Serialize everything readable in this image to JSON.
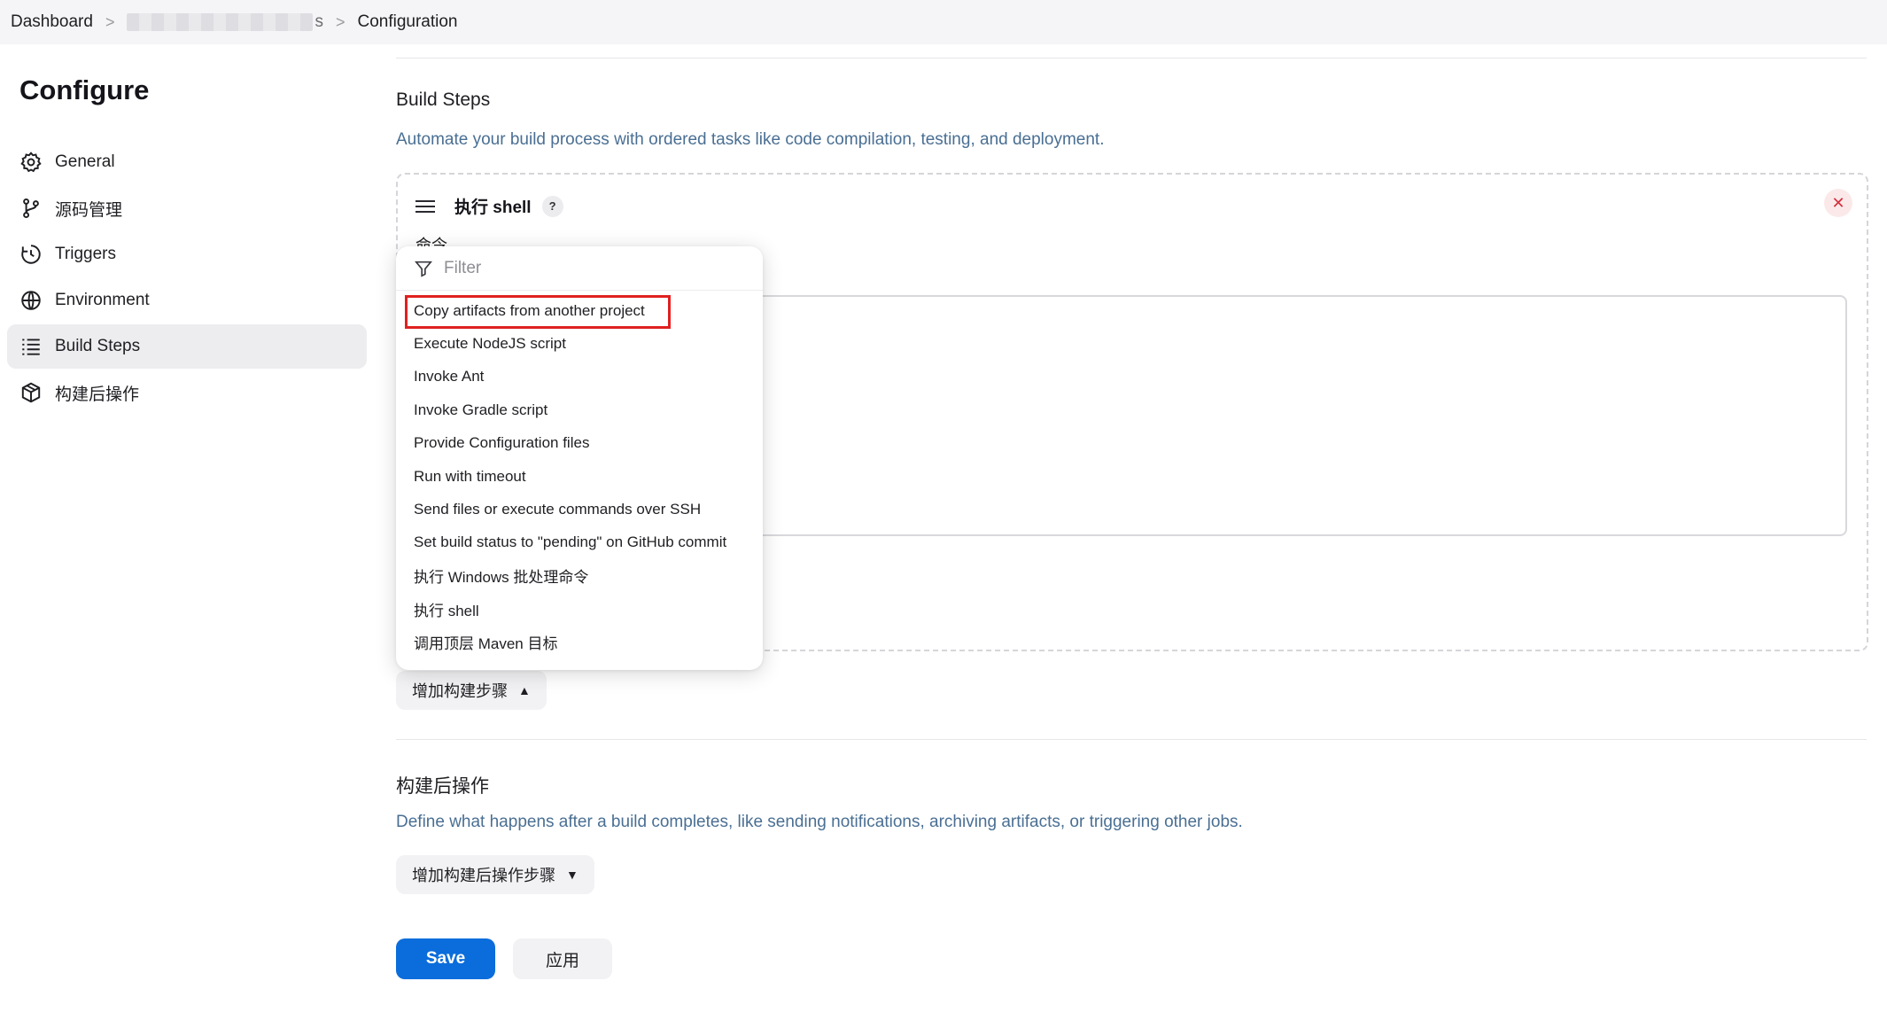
{
  "breadcrumb": {
    "items": [
      "Dashboard",
      "s",
      "Configuration"
    ],
    "separator": ">"
  },
  "sidebar": {
    "title": "Configure",
    "items": [
      {
        "label": "General",
        "icon": "gear-icon"
      },
      {
        "label": "源码管理",
        "icon": "git-branch-icon"
      },
      {
        "label": "Triggers",
        "icon": "clock-icon"
      },
      {
        "label": "Environment",
        "icon": "globe-icon"
      },
      {
        "label": "Build Steps",
        "icon": "list-icon",
        "active": true
      },
      {
        "label": "构建后操作",
        "icon": "package-icon"
      }
    ]
  },
  "build_steps": {
    "title": "Build Steps",
    "description": "Automate your build process with ordered tasks like code compilation, testing, and deployment.",
    "step": {
      "title": "执行 shell",
      "help": "?",
      "close": "✕",
      "command_label": "命令",
      "command_value": ""
    },
    "add_button": "增加构建步骤"
  },
  "dropdown": {
    "filter_placeholder": "Filter",
    "items": [
      "Copy artifacts from another project",
      "Execute NodeJS script",
      "Invoke Ant",
      "Invoke Gradle script",
      "Provide Configuration files",
      "Run with timeout",
      "Send files or execute commands over SSH",
      "Set build status to \"pending\" on GitHub commit",
      "执行 Windows 批处理命令",
      "执行 shell",
      "调用顶层 Maven 目标"
    ],
    "highlighted_index": 0,
    "highlight_color": "#e02020"
  },
  "post_build": {
    "title": "构建后操作",
    "description": "Define what happens after a build completes, like sending notifications, archiving artifacts, or triggering other jobs.",
    "add_button": "增加构建后操作步骤"
  },
  "actions": {
    "save": "Save",
    "apply": "应用"
  },
  "colors": {
    "primary": "#0b6ddb",
    "description_text": "#4a6f93",
    "danger": "#d3313c"
  }
}
